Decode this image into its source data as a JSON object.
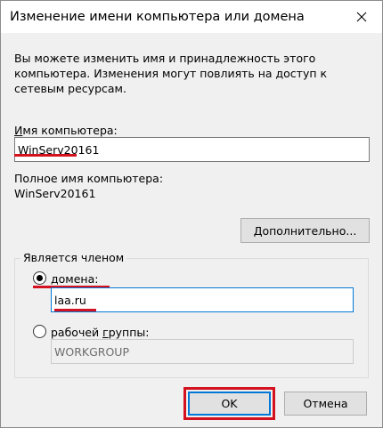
{
  "window": {
    "title": "Изменение имени компьютера или домена"
  },
  "description": "Вы можете изменить имя и принадлежность этого\nкомпьютера. Изменения могут повлиять на доступ к\nсетевым ресурсам.",
  "computer_name": {
    "label_underlined": "И",
    "label_rest": "мя компьютера:",
    "value": "WinServ20161"
  },
  "full_name": {
    "label": "Полное имя компьютера:",
    "value": "WinServ20161"
  },
  "more_button": {
    "label_underlined": "Д",
    "label_rest": "ополнительно..."
  },
  "member_of": {
    "title": "Является членом",
    "domain": {
      "label_underlined": "д",
      "label_rest": "омена:",
      "value": "laa.ru",
      "selected": true
    },
    "workgroup": {
      "label_before": "рабочей ",
      "label_underlined": "г",
      "label_rest": "руппы:",
      "value": "WORKGROUP",
      "selected": false
    }
  },
  "buttons": {
    "ok": "OK",
    "cancel": "Отмена"
  },
  "colors": {
    "highlight": "#d4111e",
    "focus": "#0078d7",
    "background": "#f0f0f0"
  }
}
